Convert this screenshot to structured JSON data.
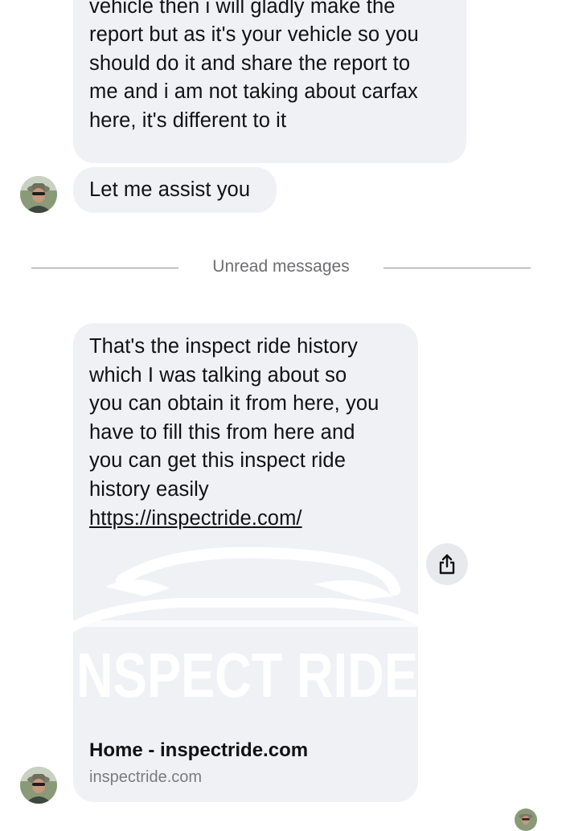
{
  "messages": [
    {
      "text": "my money again ,if it would be my\nvehicle then i will gladly make the\nreport but as it's your vehicle so you\nshould do it and share the report to\nme and i am not taking about carfax\nhere, it's different to it"
    },
    {
      "text": "Let me assist you"
    },
    {
      "text": "That's the inspect ride history\nwhich I was talking about  so\nyou can obtain it from here, you\nhave to fill this from here and\nyou can get this inspect ride\nhistory easily",
      "link": "https://inspectride.com/",
      "preview": {
        "title": "Home - inspectride.com",
        "domain": "inspectride.com",
        "logo_text": "NSPECT RIDE"
      }
    }
  ],
  "divider": {
    "label": "Unread messages"
  },
  "icons": {
    "share": "share-icon",
    "avatar": "avatar"
  }
}
